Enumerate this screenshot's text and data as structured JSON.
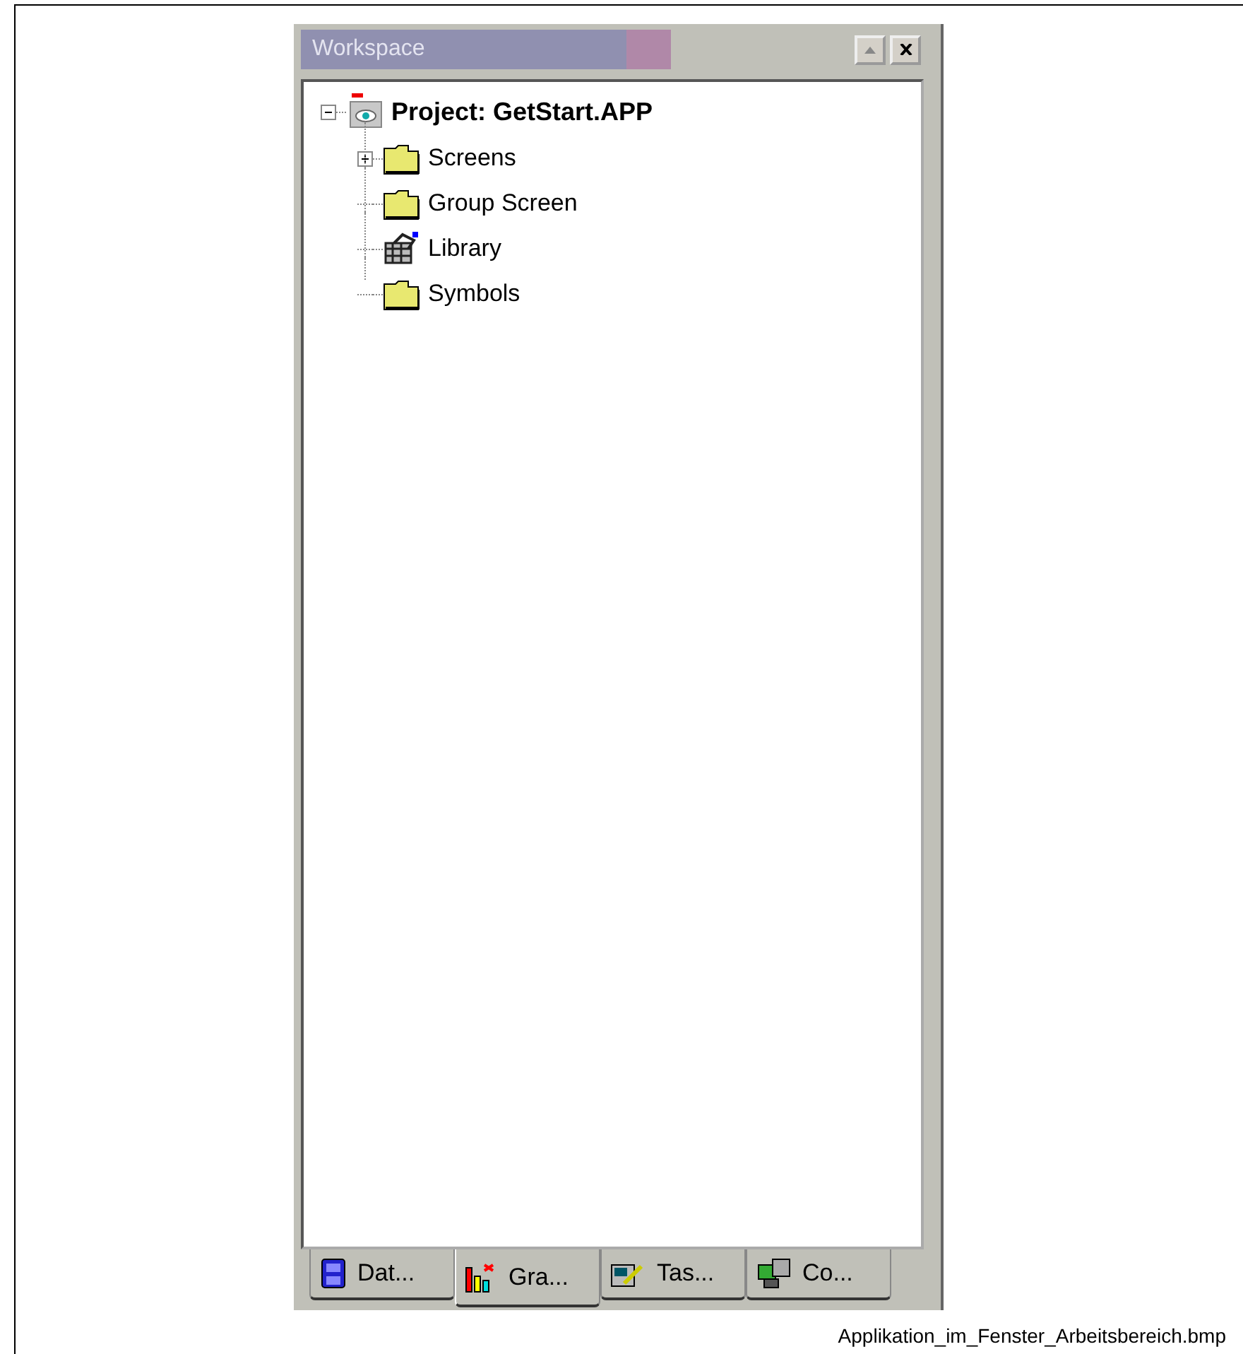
{
  "panel": {
    "title": "Workspace"
  },
  "tree": {
    "label": "Project: GetStart.APP",
    "kind": "project",
    "expanded": true,
    "children": [
      {
        "label": "Screens",
        "kind": "folder",
        "expanded": false
      },
      {
        "label": "Group Screen",
        "kind": "folder"
      },
      {
        "label": "Library",
        "kind": "library"
      },
      {
        "label": "Symbols",
        "kind": "folder"
      }
    ]
  },
  "tabs": [
    {
      "label": "Dat...",
      "kind": "data",
      "selected": false
    },
    {
      "label": "Gra...",
      "kind": "graphics",
      "selected": true
    },
    {
      "label": "Tas...",
      "kind": "tasks",
      "selected": false
    },
    {
      "label": "Co...",
      "kind": "comm",
      "selected": false
    }
  ],
  "caption": "Applikation_im_Fenster_Arbeitsbereich.bmp"
}
